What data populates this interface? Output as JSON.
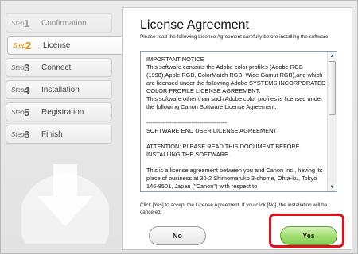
{
  "sidebar": {
    "steps": [
      {
        "word": "Step",
        "num": "1",
        "label": "Confirmation"
      },
      {
        "word": "Step",
        "num": "2",
        "label": "License"
      },
      {
        "word": "Step",
        "num": "3",
        "label": "Connect"
      },
      {
        "word": "Step",
        "num": "4",
        "label": "Installation"
      },
      {
        "word": "Step",
        "num": "5",
        "label": "Registration"
      },
      {
        "word": "Step",
        "num": "6",
        "label": "Finish"
      }
    ],
    "active_step": 2
  },
  "main": {
    "title": "License Agreement",
    "intro": "Please read the following License Agreement carefully before installing the software.",
    "license_lines": [
      "IMPORTANT NOTICE",
      "This software contains the Adobe color profiles (Adobe RGB (1998),Apple RGB, ColorMatch RGB, Wide Gamut RGB),and which are licensed under the following Adobe SYSTEMS INCORPORATED COLOR PROFILE LICENSE AGREEMENT.",
      "This software other than such Adobe color profiles is licensed under the following Canon Software License Agreement.",
      "",
      "-----------------------------------------",
      "SOFTWARE END USER LICENSE AGREEMENT",
      "",
      "ATTENTION: PLEASE READ THIS DOCUMENT BEFORE INSTALLING THE SOFTWARE.",
      "",
      "This is a license agreement between you and Canon Inc., having its place of business at 30-2 Shimomaruko 3-chome, Ohta-ku, Tokyo 146-8501, Japan (\"Canon\") with respect to"
    ],
    "note": "Click [Yes] to accept the License Agreement. If you click [No], the installation will be canceled.",
    "no_label": "No",
    "yes_label": "Yes"
  },
  "colors": {
    "accent_step": "#e08a00",
    "yes_button": "#9fdc6e",
    "highlight": "#e0101a"
  }
}
